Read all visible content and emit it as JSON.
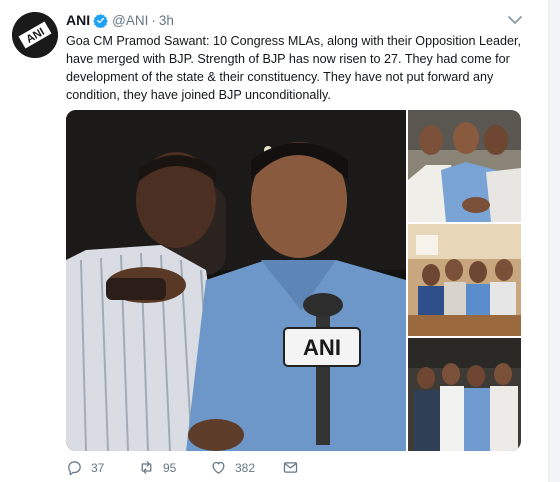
{
  "tweet": {
    "display_name": "ANI",
    "handle": "@ANI",
    "separator": "·",
    "time": "3h",
    "text": "Goa CM Pramod Sawant: 10 Congress MLAs, along with their Opposition Leader, have merged with BJP. Strength of BJP has now risen to 27. They had come for development of the state & their constituency. They have not put forward any condition, they have joined BJP unconditionally.",
    "avatar_logo": "ANI",
    "mic_logo": "ANI",
    "icons": {
      "avatar": "ani-logo",
      "verified": "verified-badge-icon",
      "menu": "chevron-down-icon",
      "reply": "reply-icon",
      "retweet": "retweet-icon",
      "like": "heart-icon",
      "dm": "envelope-icon"
    },
    "stats": {
      "replies": "37",
      "retweets": "95",
      "likes": "382"
    },
    "colors": {
      "verified": "#1da1f2",
      "muted": "#657786",
      "text": "#14171a"
    }
  }
}
